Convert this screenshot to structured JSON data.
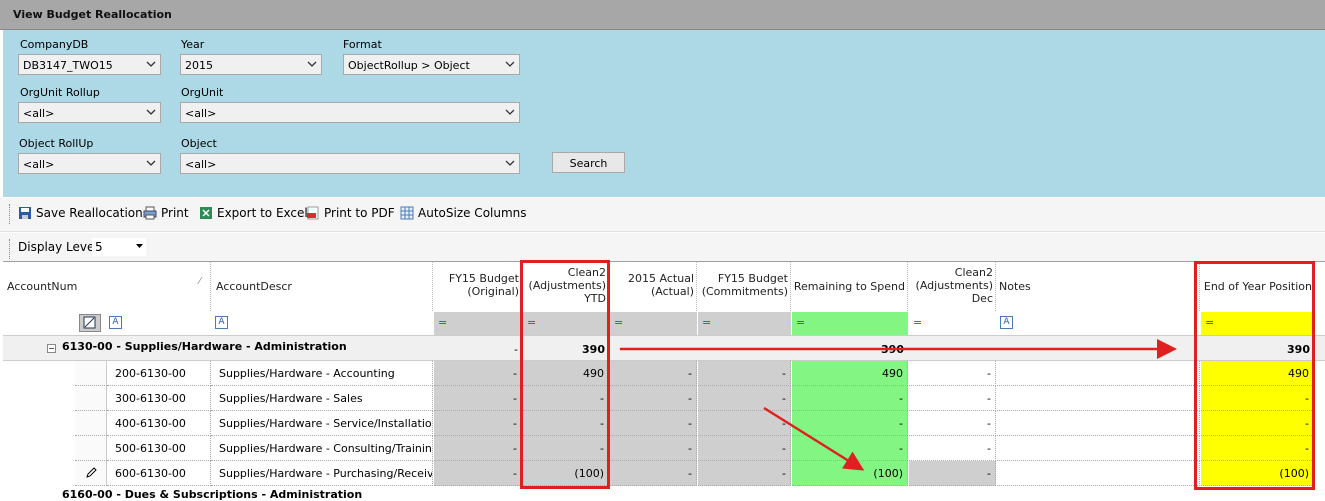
{
  "window": {
    "title": "View Budget Reallocation"
  },
  "filters": {
    "company": {
      "label": "CompanyDB",
      "value": "DB3147_TWO15"
    },
    "year": {
      "label": "Year",
      "value": "2015"
    },
    "format": {
      "label": "Format",
      "value": "ObjectRollup > Object"
    },
    "orgunit_rollup": {
      "label": "OrgUnit Rollup",
      "value": "<all>"
    },
    "orgunit": {
      "label": "OrgUnit",
      "value": "<all>"
    },
    "object_rollup": {
      "label": "Object RollUp",
      "value": "<all>"
    },
    "object": {
      "label": "Object",
      "value": "<all>"
    },
    "search_label": "Search"
  },
  "toolbar": {
    "save": "Save Reallocation",
    "print": "Print",
    "export": "Export to Excel",
    "pdf": "Print to PDF",
    "autosize": "AutoSize Columns"
  },
  "level": {
    "label": "Display Level",
    "value": "5"
  },
  "grid": {
    "columns": {
      "account_num": "AccountNum",
      "account_descr": "AccountDescr",
      "fy15_budget_l1": "FY15 Budget",
      "fy15_budget_l2": "(Original)",
      "clean2_l1": "Clean2",
      "clean2_l2": "(Adjustments)",
      "clean2_l3": "YTD",
      "actual_l1": "2015 Actual",
      "actual_l2": "(Actual)",
      "commit_l1": "FY15 Budget",
      "commit_l2": "(Commitments)",
      "remaining": "Remaining to Spend",
      "clean2dec_l1": "Clean2",
      "clean2dec_l2": "(Adjustments)",
      "clean2dec_l3": "Dec",
      "notes": "Notes",
      "eoy": "End of Year Position"
    },
    "filter_eq": "=",
    "group": {
      "label": "6130-00 - Supplies/Hardware - Administration",
      "budget": "-",
      "clean2": "390",
      "remaining": "390",
      "eoy": "390"
    },
    "rows": [
      {
        "acct": "200-6130-00",
        "descr": "Supplies/Hardware - Accounting",
        "budget": "-",
        "clean2": "490",
        "actual": "-",
        "commit": "-",
        "remaining": "490",
        "dec": "-",
        "eoy": "490"
      },
      {
        "acct": "300-6130-00",
        "descr": "Supplies/Hardware - Sales",
        "budget": "-",
        "clean2": "-",
        "actual": "-",
        "commit": "-",
        "remaining": "-",
        "dec": "-",
        "eoy": "-"
      },
      {
        "acct": "400-6130-00",
        "descr": "Supplies/Hardware - Service/Installatio",
        "budget": "-",
        "clean2": "-",
        "actual": "-",
        "commit": "-",
        "remaining": "-",
        "dec": "-",
        "eoy": "-"
      },
      {
        "acct": "500-6130-00",
        "descr": "Supplies/Hardware - Consulting/Trainin",
        "budget": "-",
        "clean2": "-",
        "actual": "-",
        "commit": "-",
        "remaining": "-",
        "dec": "-",
        "eoy": "-"
      },
      {
        "acct": "600-6130-00",
        "descr": "Supplies/Hardware - Purchasing/Receiv",
        "budget": "-",
        "clean2": "(100)",
        "actual": "-",
        "commit": "-",
        "remaining": "(100)",
        "dec": "-",
        "eoy": "(100)"
      }
    ],
    "next_group": "6160-00 - Dues & Subscriptions - Administration"
  },
  "colors": {
    "filter_bg": "#add8e6",
    "green": "#82f582",
    "yellow": "#ffff00",
    "annotation_red": "#e02020"
  }
}
